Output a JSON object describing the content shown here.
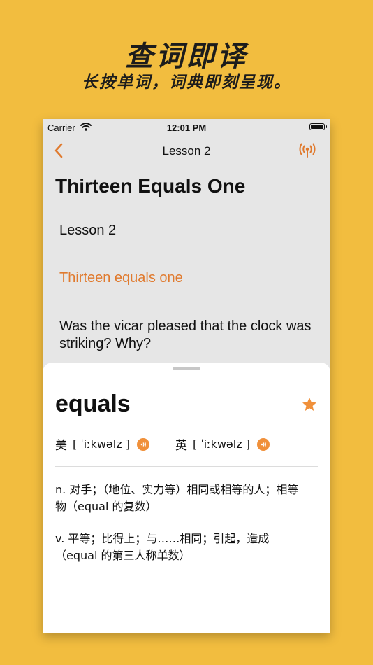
{
  "promo": {
    "title": "查词即译",
    "subtitle": "长按单词，词典即刻呈现。"
  },
  "status_bar": {
    "carrier": "Carrier",
    "time": "12:01 PM"
  },
  "nav": {
    "title": "Lesson 2",
    "back_icon": "chevron-left-icon",
    "right_icon": "broadcast-icon"
  },
  "content": {
    "heading": "Thirteen Equals One",
    "lines": [
      "Lesson 2",
      "Thirteen equals one",
      "Was the vicar pleased that the clock was striking? Why?"
    ]
  },
  "dictionary": {
    "word": "equals",
    "phonetics": [
      {
        "label": "美",
        "ipa": "[ ˈiːkwəlz ]"
      },
      {
        "label": "英",
        "ipa": "[ ˈiːkwəlz ]"
      }
    ],
    "definitions": [
      "n. 对手；（地位、实力等）相同或相等的人；相等物（equal 的复数）",
      "v. 平等；比得上；与……相同；引起，造成（equal 的第三人称单数）"
    ]
  },
  "colors": {
    "background": "#f2bd3f",
    "accent": "#e07a2e",
    "speaker": "#f0903a"
  }
}
